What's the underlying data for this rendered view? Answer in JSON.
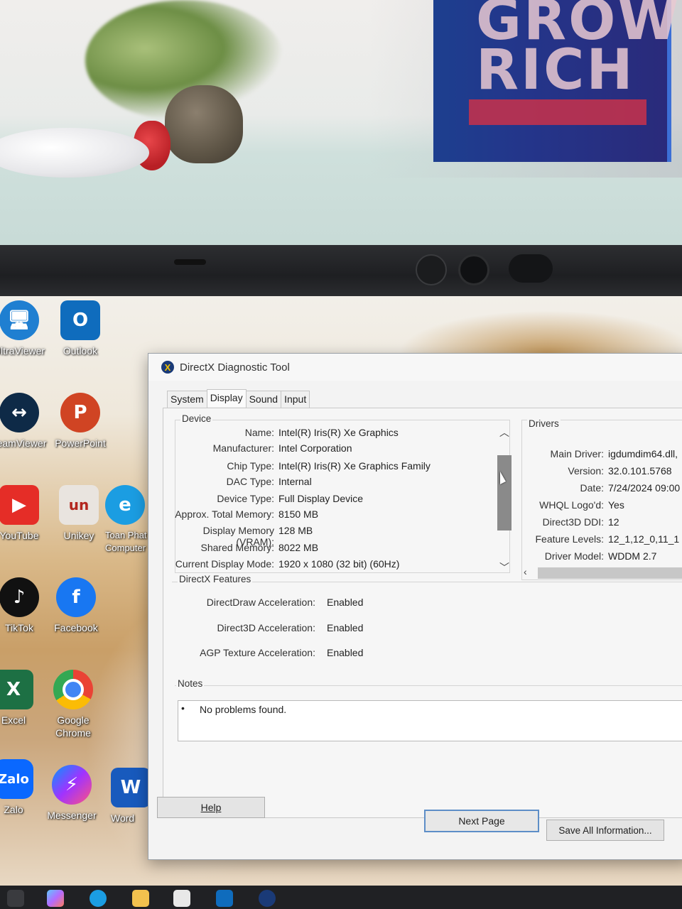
{
  "window": {
    "title": "DirectX Diagnostic Tool"
  },
  "tabs": [
    {
      "label": "System"
    },
    {
      "label": "Display"
    },
    {
      "label": "Sound"
    },
    {
      "label": "Input"
    }
  ],
  "device": {
    "group_label": "Device",
    "rows": [
      {
        "key": "Name:",
        "value": "Intel(R) Iris(R) Xe Graphics"
      },
      {
        "key": "Manufacturer:",
        "value": "Intel Corporation"
      },
      {
        "key": "Chip Type:",
        "value": "Intel(R) Iris(R) Xe Graphics Family"
      },
      {
        "key": "DAC Type:",
        "value": "Internal"
      },
      {
        "key": "Device Type:",
        "value": "Full Display Device"
      },
      {
        "key": "Approx. Total Memory:",
        "value": "8150 MB"
      },
      {
        "key": "Display Memory (VRAM):",
        "value": "128 MB"
      },
      {
        "key": "Shared Memory:",
        "value": "8022 MB"
      },
      {
        "key": "Current Display Mode:",
        "value": "1920 x 1080 (32 bit) (60Hz)"
      }
    ]
  },
  "drivers": {
    "group_label": "Drivers",
    "rows": [
      {
        "key": "Main Driver:",
        "value": "igdumdim64.dll,"
      },
      {
        "key": "Version:",
        "value": "32.0.101.5768"
      },
      {
        "key": "Date:",
        "value": "7/24/2024 09:00"
      },
      {
        "key": "WHQL Logo'd:",
        "value": "Yes"
      },
      {
        "key": "Direct3D DDI:",
        "value": "12"
      },
      {
        "key": "Feature Levels:",
        "value": "12_1,12_0,11_1"
      },
      {
        "key": "Driver Model:",
        "value": "WDDM 2.7"
      }
    ]
  },
  "features": {
    "group_label": "DirectX Features",
    "rows": [
      {
        "key": "DirectDraw Acceleration:",
        "value": "Enabled"
      },
      {
        "key": "Direct3D Acceleration:",
        "value": "Enabled"
      },
      {
        "key": "AGP Texture Acceleration:",
        "value": "Enabled"
      }
    ]
  },
  "notes": {
    "group_label": "Notes",
    "bullet": "•",
    "text": "No problems found."
  },
  "buttons": {
    "help": "Help",
    "next_page": "Next Page",
    "save_all": "Save All Information..."
  },
  "desktop_icons": [
    {
      "label": "UltraViewer",
      "icon": "ultraviewer-icon"
    },
    {
      "label": "Outlook",
      "icon": "outlook-icon"
    },
    {
      "label": "TeamViewer",
      "icon": "teamviewer-icon"
    },
    {
      "label": "PowerPoint",
      "icon": "powerpoint-icon"
    },
    {
      "label": "YouTube",
      "icon": "youtube-icon"
    },
    {
      "label": "Unikey",
      "icon": "unikey-icon"
    },
    {
      "label": "Toan Phat Computer",
      "icon": "edge-shortcut-icon"
    },
    {
      "label": "TikTok",
      "icon": "tiktok-icon"
    },
    {
      "label": "Facebook",
      "icon": "facebook-icon"
    },
    {
      "label": "Excel",
      "icon": "excel-icon"
    },
    {
      "label": "Google Chrome",
      "icon": "chrome-icon"
    },
    {
      "label": "Zalo",
      "icon": "zalo-icon"
    },
    {
      "label": "Messenger",
      "icon": "messenger-icon"
    },
    {
      "label": "Word",
      "icon": "word-icon"
    }
  ],
  "book_cover_text": "GROW RICH",
  "colors": {
    "dialog_bg": "#f3f3f3",
    "default_button_border": "#5d8ec7",
    "scroll_thumb": "#8a8a8a"
  }
}
